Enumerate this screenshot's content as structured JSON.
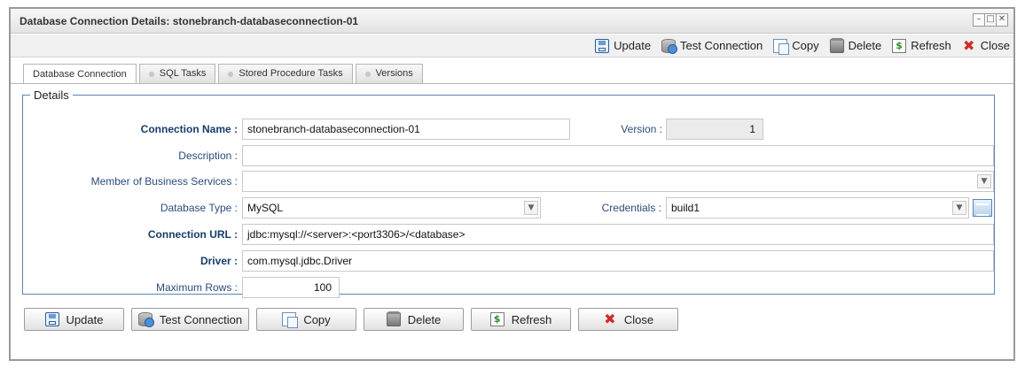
{
  "window": {
    "title": "Database Connection Details: stonebranch-databaseconnection-01",
    "controls": [
      "–",
      "□",
      "✕"
    ]
  },
  "toolbar": {
    "update": "Update",
    "test_connection": "Test Connection",
    "copy": "Copy",
    "delete": "Delete",
    "refresh": "Refresh",
    "close": "Close"
  },
  "tabs": [
    {
      "label": "Database Connection",
      "active": true
    },
    {
      "label": "SQL Tasks",
      "active": false
    },
    {
      "label": "Stored Procedure Tasks",
      "active": false
    },
    {
      "label": "Versions",
      "active": false
    }
  ],
  "details": {
    "legend": "Details",
    "connection_name_label": "Connection Name :",
    "connection_name_value": "stonebranch-databaseconnection-01",
    "version_label": "Version :",
    "version_value": "1",
    "description_label": "Description :",
    "description_value": "",
    "member_label": "Member of Business Services :",
    "member_value": "",
    "database_type_label": "Database Type :",
    "database_type_value": "MySQL",
    "credentials_label": "Credentials :",
    "credentials_value": "build1",
    "connection_url_label": "Connection URL :",
    "connection_url_value": "jdbc:mysql://<server>:<port3306>/<database>",
    "driver_label": "Driver :",
    "driver_value": "com.mysql.jdbc.Driver",
    "max_rows_label": "Maximum Rows :",
    "max_rows_value": "100"
  },
  "buttons": {
    "update": "Update",
    "test_connection": "Test Connection",
    "copy": "Copy",
    "delete": "Delete",
    "refresh": "Refresh",
    "close": "Close"
  },
  "icons": {
    "update": "save-icon",
    "test_connection": "database-test-icon",
    "copy": "copy-icon",
    "delete": "delete-icon",
    "refresh": "refresh-icon",
    "close": "close-icon"
  },
  "colors": {
    "label_blue": "#173d6b",
    "fieldset_border": "#5a84b4",
    "close_red": "#d02b2b"
  }
}
